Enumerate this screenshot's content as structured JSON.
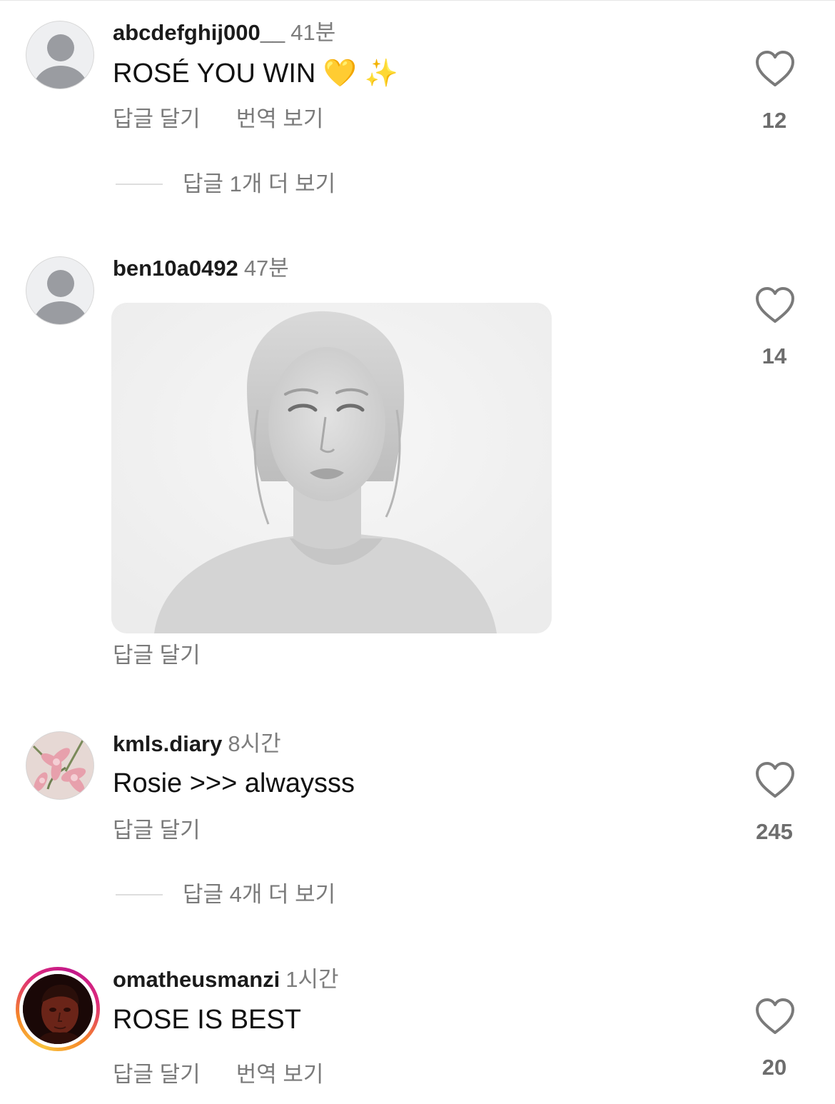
{
  "comments": [
    {
      "username": "abcdefghij000__",
      "time": "41분",
      "text": "ROSÉ YOU WIN ",
      "emojis": [
        "💛",
        "✨"
      ],
      "likes": "12",
      "actions": {
        "reply": "답글 달기",
        "translate": "번역 보기"
      },
      "more_replies": "답글 1개 더 보기"
    },
    {
      "username": "ben10a0492",
      "time": "47분",
      "media": "grayscale-portrait-photo",
      "likes": "14",
      "actions": {
        "reply": "답글 달기"
      }
    },
    {
      "username": "kmls.diary",
      "time": "8시간",
      "text": "Rosie >>> alwaysss",
      "likes": "245",
      "actions": {
        "reply": "답글 달기"
      },
      "more_replies": "답글 4개 더 보기"
    },
    {
      "username": "omatheusmanzi",
      "time": "1시간",
      "text": "ROSE IS BEST",
      "likes": "20",
      "actions": {
        "reply": "답글 달기",
        "translate": "번역 보기"
      },
      "has_story_ring": true
    }
  ],
  "icons": {
    "like": "heart-outline-icon",
    "default_avatar": "person-silhouette-icon"
  },
  "colors": {
    "text": "#111111",
    "secondary": "#7a7a7a",
    "divider": "#dedede",
    "story_ring": [
      "#f9c23c",
      "#dd2a7b"
    ]
  }
}
